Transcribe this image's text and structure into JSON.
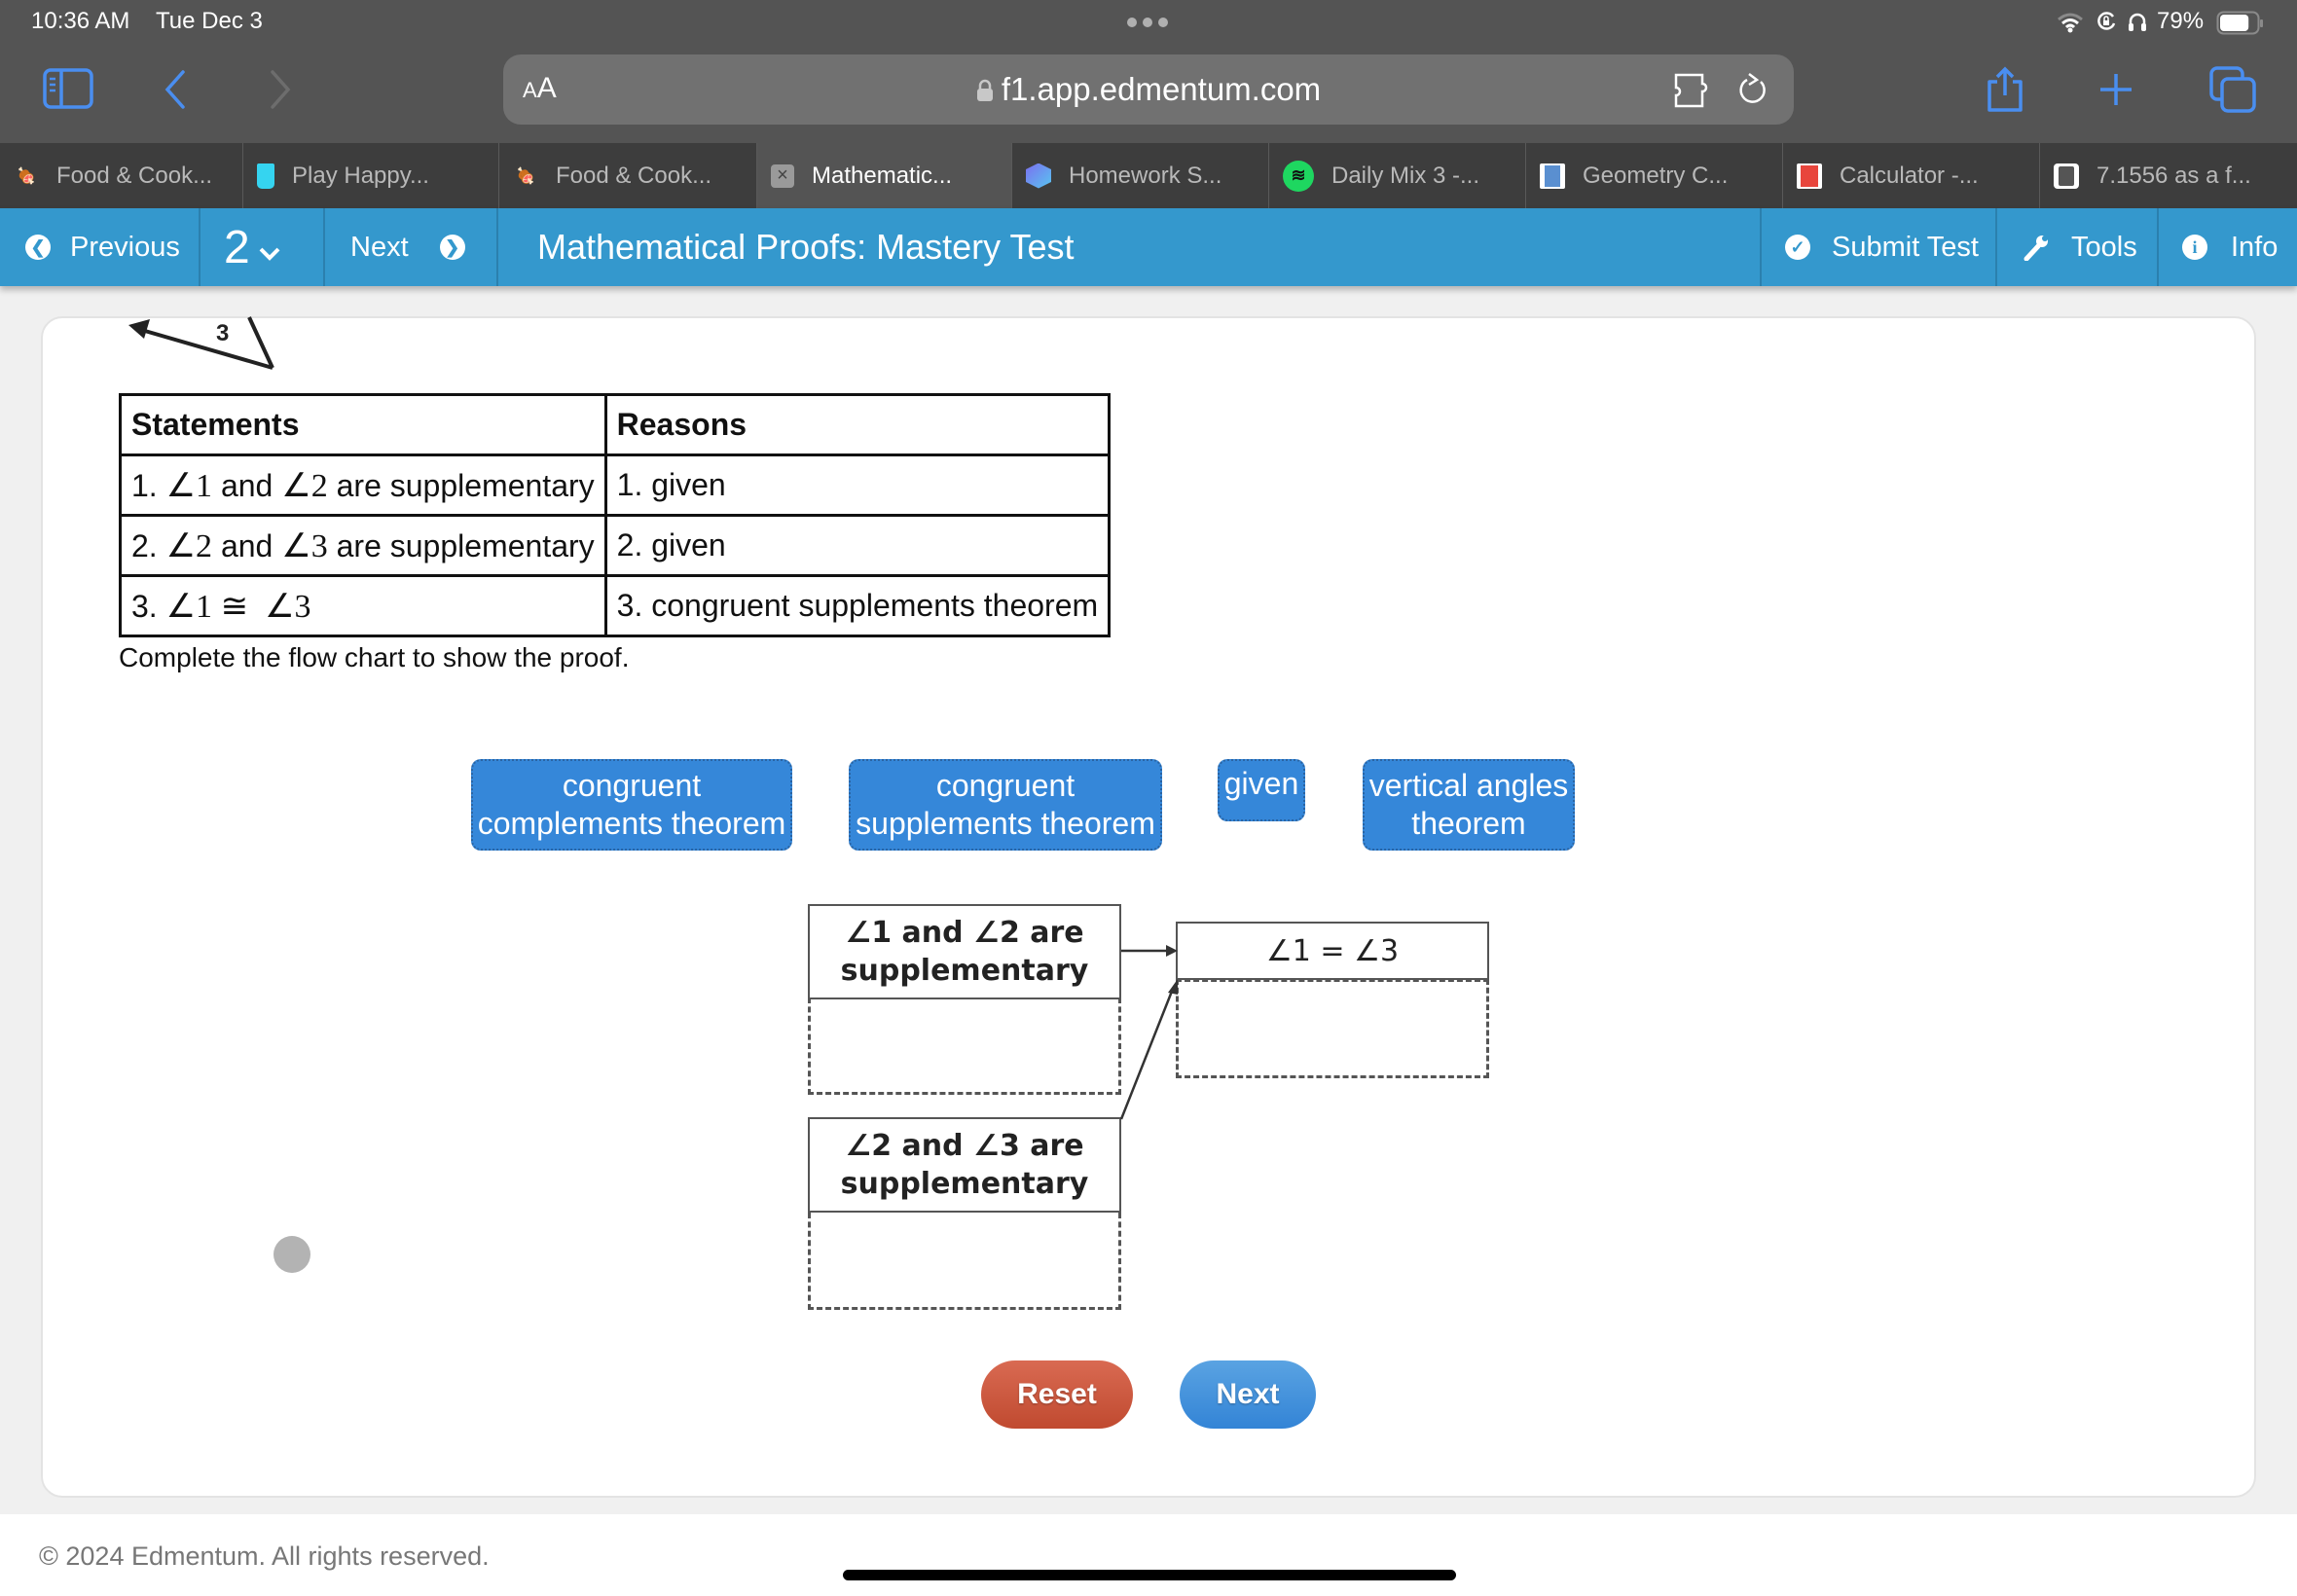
{
  "status_bar": {
    "time": "10:36 AM",
    "date": "Tue Dec 3",
    "battery_percent": "79%",
    "battery_level": 0.79,
    "icons": [
      "wifi-icon",
      "orientation-lock-icon",
      "headphones-icon",
      "battery-icon"
    ]
  },
  "browser": {
    "text_size_label": "AA",
    "url": "f1.app.edmentum.com",
    "toolbar_icons": [
      "sidebar-icon",
      "back-icon",
      "forward-icon",
      "extension-icon",
      "reload-icon",
      "share-icon",
      "new-tab-icon",
      "tabs-overview-icon"
    ],
    "tabs": [
      {
        "label": "Food & Cook...",
        "icon": "food-favicon",
        "active": false
      },
      {
        "label": "Play Happy...",
        "icon": "glass-favicon",
        "active": false
      },
      {
        "label": "Food & Cook...",
        "icon": "food-favicon",
        "active": false
      },
      {
        "label": "Mathematic...",
        "icon": "close-tab-icon",
        "active": true
      },
      {
        "label": "Homework S...",
        "icon": "gem-favicon",
        "active": false
      },
      {
        "label": "Daily Mix 3 -...",
        "icon": "spotify-favicon",
        "active": false
      },
      {
        "label": "Geometry C...",
        "icon": "calculator-blue-favicon",
        "active": false
      },
      {
        "label": "Calculator -...",
        "icon": "calculator-red-favicon",
        "active": false
      },
      {
        "label": "7.1556 as a f...",
        "icon": "calculator-gray-favicon",
        "active": false
      }
    ]
  },
  "nav": {
    "previous_label": "Previous",
    "question_number": "2",
    "next_label": "Next",
    "title": "Mathematical Proofs: Mastery Test",
    "submit_label": "Submit Test",
    "tools_label": "Tools",
    "info_label": "Info"
  },
  "figure": {
    "angle_label": "3"
  },
  "proof_table": {
    "headers": [
      "Statements",
      "Reasons"
    ],
    "rows": [
      {
        "num": "1.",
        "a1": "∠1",
        "mid": " and ",
        "a2": "∠2",
        "tail": " are supplementary",
        "reason": "1. given"
      },
      {
        "num": "2.",
        "a1": "∠2",
        "mid": " and ",
        "a2": "∠3",
        "tail": " are supplementary",
        "reason": "2. given"
      },
      {
        "num": "3.",
        "a1": "∠1",
        "mid": " ≅  ",
        "a2": "∠3",
        "tail": "",
        "reason": "3. congruent supplements theorem"
      }
    ]
  },
  "instruction": "Complete the flow chart to show the proof.",
  "answer_tiles": [
    {
      "line1": "congruent",
      "line2": "complements theorem"
    },
    {
      "line1": "congruent",
      "line2": "supplements theorem"
    },
    {
      "line1": "given",
      "line2": ""
    },
    {
      "line1": "vertical angles",
      "line2": "theorem"
    }
  ],
  "flow_chart": {
    "box1": {
      "line1": "∠1 and ∠2 are",
      "line2": "supplementary"
    },
    "box2": {
      "line1": "∠2 and ∠3 are",
      "line2": "supplementary"
    },
    "box3": {
      "line1": "∠1 = ∠3"
    }
  },
  "buttons": {
    "reset": "Reset",
    "next": "Next"
  },
  "footer": {
    "copyright": "© 2024 Edmentum. All rights reserved."
  }
}
